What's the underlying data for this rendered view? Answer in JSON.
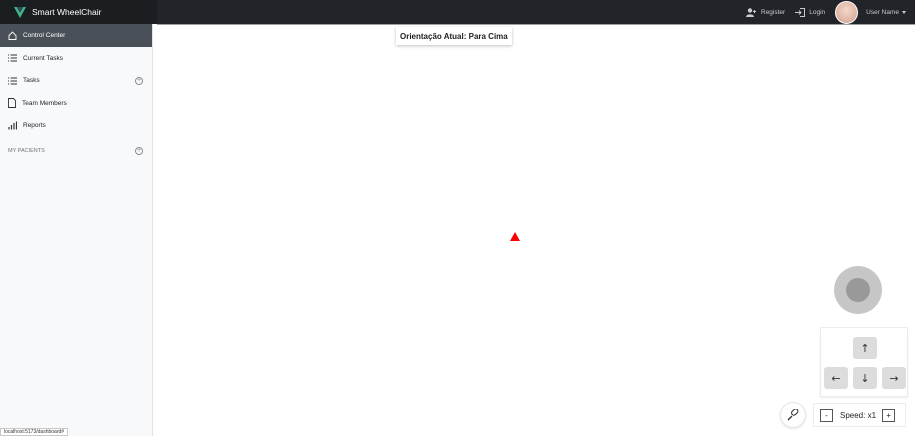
{
  "app": {
    "title": "Smart WheelChair"
  },
  "topbar": {
    "register_label": "Register",
    "login_label": "Login",
    "user_name": "User Name"
  },
  "sidebar": {
    "items": [
      {
        "label": "Control Center",
        "icon": "home-icon",
        "active": true
      },
      {
        "label": "Current Tasks",
        "icon": "list-icon"
      },
      {
        "label": "Tasks",
        "icon": "list-icon"
      },
      {
        "label": "Team Members",
        "icon": "file-icon"
      },
      {
        "label": "Reports",
        "icon": "bar-chart-icon"
      }
    ],
    "section_heading": "MY PACIENTS"
  },
  "main": {
    "orientation_text": "Orientação Atual: Para Cima",
    "arrows": {
      "up": "↑",
      "down": "↓",
      "left": "←",
      "right": "→"
    },
    "speed": {
      "label": "Speed: x1",
      "decrease": "-",
      "increase": "+"
    }
  },
  "status_bar": {
    "url": "localhost:5173/dashboard#"
  },
  "colors": {
    "topbar": "#212529",
    "active_item": "#495057",
    "marker": "#ff0000"
  }
}
